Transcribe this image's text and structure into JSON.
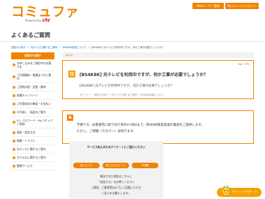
{
  "header": {
    "logo_text": "コミュファ",
    "logo_powered": "Powered by",
    "logo_brand": "ctc",
    "btn_web_user": "Webユーザー登録",
    "btn_my": "Myコミュファログイン"
  },
  "page_title": "よくあるご質問",
  "breadcrumb": {
    "items": [
      "回答から探す",
      "光テレビに関するご案内",
      "BS4K8K放送について"
    ],
    "current": "[BS4K8K] 光テレビを利用中ですが、何か工事が必要でしょうか？"
  },
  "sidebar": {
    "heading": "目的から探す",
    "items": [
      "お申し込みをご検討中のお客さま",
      "ご利用開始・開通までのご案内",
      "ご契約内容・変更・解約",
      "各種キャンペーン",
      "ご利用料金の確認・お支払い",
      "お引越し・転居のご案内",
      "ID・パスワード・Myコミュファ登録",
      "接続・設定方法",
      "故障・トラブル",
      "光テレビに関するご案内",
      "光でんわに関するご案内",
      "関連サービス"
    ]
  },
  "main": {
    "back_label": "戻る",
    "question": {
      "badge": "Q",
      "title": "[BS4K8K] 光テレビを利用中ですが、何か工事が必要でしょうか？",
      "meta": "No：375",
      "subtitle": "[BS4K8K] 光テレビを利用中ですが、何か工事が必要でしょうか？",
      "category": "カテゴリー： 回答から探す ＞ 光テレビに関するご案内 ＞ BS4K8K放送について"
    },
    "answer": {
      "badge": "A",
      "line1": "不要です。お客様宅に取り付け済のV-ONUまで、新4K8K衛星放送の電波をご提供します。",
      "line2": "ただし、ご視聴（スカパー）は除きます。"
    },
    "survey": {
      "title": "サービス向上のためアンケートにご協力ください",
      "buttons": [
        "役に立った",
        "役に立たなかった",
        "不明瞭"
      ],
      "note_lines": [
        "解決された場合はこちらに",
        "「送信する」をお押しください",
        "ご意見・ご要望等は以下にご記載いただき",
        "ご記入をお願いします。"
      ]
    }
  },
  "chat": {
    "label": "チャットサポート"
  }
}
